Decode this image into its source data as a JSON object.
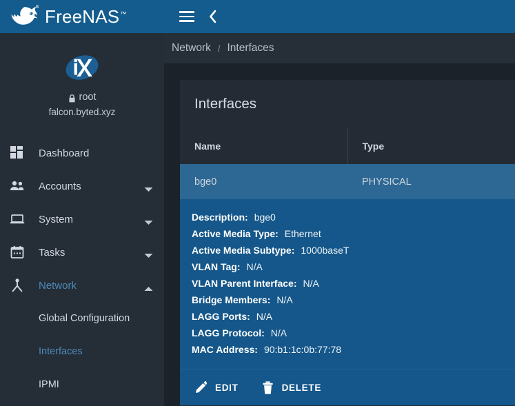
{
  "app": {
    "brand_name": "FreeNAS",
    "brand_tm": "™",
    "logo_icon": "freenas-shark-logo"
  },
  "topbar": {
    "menu_icon": "hamburger-menu-icon",
    "back_icon": "chevron-left-icon"
  },
  "sidebar": {
    "logo_icon": "ix-systems-logo",
    "lock_icon": "lock-icon",
    "username": "root",
    "hostname": "falcon.byted.xyz",
    "items": [
      {
        "label": "Dashboard",
        "icon": "dashboard-grid-icon",
        "expandable": false,
        "active": false
      },
      {
        "label": "Accounts",
        "icon": "people-group-icon",
        "expandable": true,
        "expanded": false,
        "active": false
      },
      {
        "label": "System",
        "icon": "laptop-icon",
        "expandable": true,
        "expanded": false,
        "active": false
      },
      {
        "label": "Tasks",
        "icon": "calendar-icon",
        "expandable": true,
        "expanded": false,
        "active": false
      },
      {
        "label": "Network",
        "icon": "network-node-icon",
        "expandable": true,
        "expanded": true,
        "active": true
      }
    ],
    "network_subitems": [
      {
        "label": "Global Configuration",
        "active": false
      },
      {
        "label": "Interfaces",
        "active": true
      },
      {
        "label": "IPMI",
        "active": false
      }
    ]
  },
  "breadcrumb": {
    "parent": "Network",
    "separator": "/",
    "current": "Interfaces"
  },
  "main": {
    "card_title": "Interfaces",
    "table": {
      "columns": [
        "Name",
        "Type"
      ],
      "rows": [
        {
          "name": "bge0",
          "type": "PHYSICAL",
          "selected": true
        }
      ]
    },
    "detail": {
      "rows": [
        {
          "label": "Description:",
          "value": "bge0"
        },
        {
          "label": "Active Media Type:",
          "value": "Ethernet"
        },
        {
          "label": "Active Media Subtype:",
          "value": "1000baseT"
        },
        {
          "label": "VLAN Tag:",
          "value": "N/A"
        },
        {
          "label": "VLAN Parent Interface:",
          "value": "N/A"
        },
        {
          "label": "Bridge Members:",
          "value": "N/A"
        },
        {
          "label": "LAGG Ports:",
          "value": "N/A"
        },
        {
          "label": "LAGG Protocol:",
          "value": "N/A"
        },
        {
          "label": "MAC Address:",
          "value": "90:b1:1c:0b:77:78"
        }
      ]
    },
    "actions": [
      {
        "label": "EDIT",
        "icon": "pencil-icon"
      },
      {
        "label": "DELETE",
        "icon": "trash-icon"
      }
    ]
  },
  "colors": {
    "brand_blue": "#135c8d",
    "sidebar_bg": "#252d37",
    "page_bg": "#1c222a",
    "card_bg": "#242b35",
    "row_selected": "#2d6793",
    "detail_panel": "#15578a",
    "accent_link": "#4c8ab8"
  }
}
